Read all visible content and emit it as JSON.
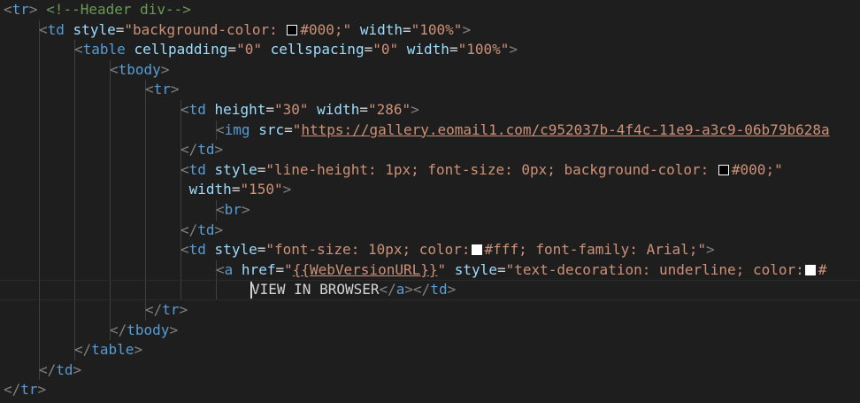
{
  "editor": {
    "colors": {
      "background": "#1e1e1e",
      "tag": "#569cd6",
      "attribute": "#9cdcfe",
      "string": "#ce9178",
      "comment": "#6a9955",
      "punctuation": "#808080",
      "text": "#d4d4d4"
    },
    "lines": [
      {
        "indent": 0,
        "tokens": [
          {
            "t": "punct",
            "v": "<"
          },
          {
            "t": "tag",
            "v": "tr"
          },
          {
            "t": "punct",
            "v": "> "
          },
          {
            "t": "comment",
            "v": "<!--Header div-->"
          }
        ]
      },
      {
        "indent": 1,
        "tokens": [
          {
            "t": "punct",
            "v": "<"
          },
          {
            "t": "tag",
            "v": "td"
          },
          {
            "t": "text",
            "v": " "
          },
          {
            "t": "attr",
            "v": "style"
          },
          {
            "t": "text",
            "v": "="
          },
          {
            "t": "str",
            "v": "\"background-color: "
          },
          {
            "t": "swatch",
            "v": "#000000"
          },
          {
            "t": "str",
            "v": "#000;\""
          },
          {
            "t": "text",
            "v": " "
          },
          {
            "t": "attr",
            "v": "width"
          },
          {
            "t": "text",
            "v": "="
          },
          {
            "t": "str",
            "v": "\"100%\""
          },
          {
            "t": "punct",
            "v": ">"
          }
        ]
      },
      {
        "indent": 2,
        "tokens": [
          {
            "t": "punct",
            "v": "<"
          },
          {
            "t": "tag",
            "v": "table"
          },
          {
            "t": "text",
            "v": " "
          },
          {
            "t": "attr",
            "v": "cellpadding"
          },
          {
            "t": "text",
            "v": "="
          },
          {
            "t": "str",
            "v": "\"0\""
          },
          {
            "t": "text",
            "v": " "
          },
          {
            "t": "attr",
            "v": "cellspacing"
          },
          {
            "t": "text",
            "v": "="
          },
          {
            "t": "str",
            "v": "\"0\""
          },
          {
            "t": "text",
            "v": " "
          },
          {
            "t": "attr",
            "v": "width"
          },
          {
            "t": "text",
            "v": "="
          },
          {
            "t": "str",
            "v": "\"100%\""
          },
          {
            "t": "punct",
            "v": ">"
          }
        ]
      },
      {
        "indent": 3,
        "tokens": [
          {
            "t": "punct",
            "v": "<"
          },
          {
            "t": "tag",
            "v": "tbody"
          },
          {
            "t": "punct",
            "v": ">"
          }
        ]
      },
      {
        "indent": 4,
        "tokens": [
          {
            "t": "punct",
            "v": "<"
          },
          {
            "t": "tag",
            "v": "tr"
          },
          {
            "t": "punct",
            "v": ">"
          }
        ]
      },
      {
        "indent": 5,
        "tokens": [
          {
            "t": "punct",
            "v": "<"
          },
          {
            "t": "tag",
            "v": "td"
          },
          {
            "t": "text",
            "v": " "
          },
          {
            "t": "attr",
            "v": "height"
          },
          {
            "t": "text",
            "v": "="
          },
          {
            "t": "str",
            "v": "\"30\""
          },
          {
            "t": "text",
            "v": " "
          },
          {
            "t": "attr",
            "v": "width"
          },
          {
            "t": "text",
            "v": "="
          },
          {
            "t": "str",
            "v": "\"286\""
          },
          {
            "t": "punct",
            "v": ">"
          }
        ]
      },
      {
        "indent": 6,
        "tokens": [
          {
            "t": "punct",
            "v": "<"
          },
          {
            "t": "tag",
            "v": "img"
          },
          {
            "t": "text",
            "v": " "
          },
          {
            "t": "attr",
            "v": "src"
          },
          {
            "t": "text",
            "v": "="
          },
          {
            "t": "str",
            "v": "\""
          },
          {
            "t": "link",
            "v": "https://gallery.eomail1.com/c952037b-4f4c-11e9-a3c9-06b79b628a"
          }
        ]
      },
      {
        "indent": 5,
        "tokens": [
          {
            "t": "punct",
            "v": "</"
          },
          {
            "t": "tag",
            "v": "td"
          },
          {
            "t": "punct",
            "v": ">"
          }
        ]
      },
      {
        "indent": 5,
        "tokens": [
          {
            "t": "punct",
            "v": "<"
          },
          {
            "t": "tag",
            "v": "td"
          },
          {
            "t": "text",
            "v": " "
          },
          {
            "t": "attr",
            "v": "style"
          },
          {
            "t": "text",
            "v": "="
          },
          {
            "t": "str",
            "v": "\"line-height: 1px; font-size: 0px; background-color: "
          },
          {
            "t": "swatch",
            "v": "#000000"
          },
          {
            "t": "str",
            "v": "#000;\""
          }
        ]
      },
      {
        "indent": 5,
        "tokens": [
          {
            "t": "text",
            "v": " "
          },
          {
            "t": "attr",
            "v": "width"
          },
          {
            "t": "text",
            "v": "="
          },
          {
            "t": "str",
            "v": "\"150\""
          },
          {
            "t": "punct",
            "v": ">"
          }
        ]
      },
      {
        "indent": 6,
        "tokens": [
          {
            "t": "punct",
            "v": "<"
          },
          {
            "t": "tag",
            "v": "br"
          },
          {
            "t": "punct",
            "v": ">"
          }
        ]
      },
      {
        "indent": 5,
        "tokens": [
          {
            "t": "punct",
            "v": "</"
          },
          {
            "t": "tag",
            "v": "td"
          },
          {
            "t": "punct",
            "v": ">"
          }
        ]
      },
      {
        "indent": 5,
        "tokens": [
          {
            "t": "punct",
            "v": "<"
          },
          {
            "t": "tag",
            "v": "td"
          },
          {
            "t": "text",
            "v": " "
          },
          {
            "t": "attr",
            "v": "style"
          },
          {
            "t": "text",
            "v": "="
          },
          {
            "t": "str",
            "v": "\"font-size: 10px; color:"
          },
          {
            "t": "swatch",
            "v": "#ffffff"
          },
          {
            "t": "str",
            "v": "#fff; font-family: Arial;\""
          },
          {
            "t": "punct",
            "v": ">"
          }
        ]
      },
      {
        "indent": 6,
        "tokens": [
          {
            "t": "punct",
            "v": "<"
          },
          {
            "t": "tag",
            "v": "a"
          },
          {
            "t": "text",
            "v": " "
          },
          {
            "t": "attr",
            "v": "href"
          },
          {
            "t": "text",
            "v": "="
          },
          {
            "t": "str",
            "v": "\""
          },
          {
            "t": "link",
            "v": "{{WebVersionURL}}"
          },
          {
            "t": "str",
            "v": "\""
          },
          {
            "t": "text",
            "v": " "
          },
          {
            "t": "attr",
            "v": "style"
          },
          {
            "t": "text",
            "v": "="
          },
          {
            "t": "str",
            "v": "\"text-decoration: underline; color:"
          },
          {
            "t": "swatch",
            "v": "#ffffff"
          },
          {
            "t": "str",
            "v": "#"
          }
        ]
      },
      {
        "indent": 7,
        "tokens": [
          {
            "t": "text",
            "v": "VIEW IN BROWSER"
          },
          {
            "t": "punct",
            "v": "</"
          },
          {
            "t": "tag",
            "v": "a"
          },
          {
            "t": "punct",
            "v": "></"
          },
          {
            "t": "tag",
            "v": "td"
          },
          {
            "t": "punct",
            "v": ">"
          }
        ]
      },
      {
        "indent": 4,
        "tokens": [
          {
            "t": "punct",
            "v": "</"
          },
          {
            "t": "tag",
            "v": "tr"
          },
          {
            "t": "punct",
            "v": ">"
          }
        ]
      },
      {
        "indent": 3,
        "tokens": [
          {
            "t": "punct",
            "v": "</"
          },
          {
            "t": "tag",
            "v": "tbody"
          },
          {
            "t": "punct",
            "v": ">"
          }
        ]
      },
      {
        "indent": 2,
        "tokens": [
          {
            "t": "punct",
            "v": "</"
          },
          {
            "t": "tag",
            "v": "table"
          },
          {
            "t": "punct",
            "v": ">"
          }
        ]
      },
      {
        "indent": 1,
        "tokens": [
          {
            "t": "punct",
            "v": "</"
          },
          {
            "t": "tag",
            "v": "td"
          },
          {
            "t": "punct",
            "v": ">"
          }
        ]
      },
      {
        "indent": 0,
        "tokens": [
          {
            "t": "punct",
            "v": "</"
          },
          {
            "t": "tag",
            "v": "tr"
          },
          {
            "t": "punct",
            "v": ">"
          }
        ]
      }
    ]
  }
}
